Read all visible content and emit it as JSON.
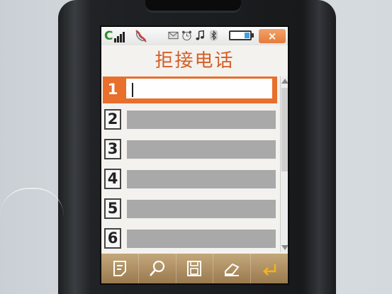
{
  "screen": {
    "title": "拒接电话",
    "status_bar": {
      "signal_label": "C",
      "icons": [
        "no-call-icon",
        "message-icon",
        "alarm-icon",
        "music-icon",
        "bluetooth-icon",
        "battery-icon"
      ],
      "close_label": "×"
    },
    "list": [
      {
        "number": "1",
        "value": "",
        "selected": true
      },
      {
        "number": "2",
        "value": ""
      },
      {
        "number": "3",
        "value": ""
      },
      {
        "number": "4",
        "value": ""
      },
      {
        "number": "5",
        "value": ""
      },
      {
        "number": "6",
        "value": ""
      }
    ],
    "softkeys": [
      "notes-icon",
      "search-icon",
      "save-icon",
      "eraser-icon",
      "back-icon"
    ]
  },
  "colors": {
    "accent": "#e86f2c",
    "title": "#d55d28",
    "field": "#a9a9a9",
    "toolbar": "#b69763"
  }
}
